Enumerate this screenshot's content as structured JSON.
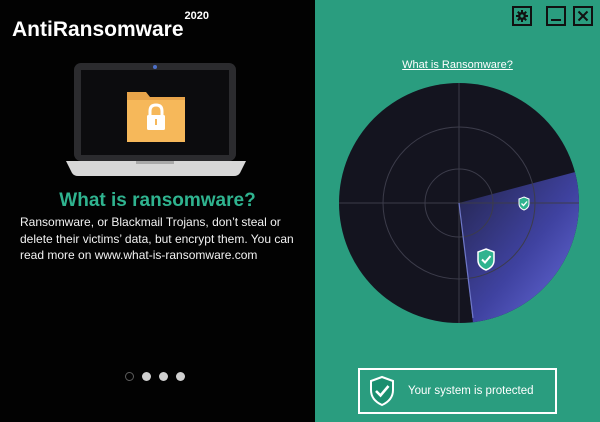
{
  "app": {
    "name": "AntiRansomware",
    "version_sup": "2020"
  },
  "slide": {
    "heading": "What is ransomware?",
    "body": "Ransomware, or Blackmail Trojans, don’t steal or delete their victims’ data, but encrypt them. You can read more on www.what-is-ransomware.com",
    "total": 4,
    "active_index": 0
  },
  "right": {
    "link": "What is Ransomware?",
    "status_text": "Your system is protected"
  },
  "icons": {
    "back": "chevron-left-icon",
    "settings": "gear-icon",
    "minimize": "minimize-icon",
    "close": "close-icon",
    "laptop": "laptop-lock-folder-icon",
    "shield": "shield-check-icon"
  },
  "colors": {
    "left_bg": "#020202",
    "right_bg": "#2a9d7f",
    "accent": "#2fb38f",
    "radar_bg": "#14141f",
    "radar_sweep": "#5a5fd0",
    "folder": "#f6b85a"
  }
}
